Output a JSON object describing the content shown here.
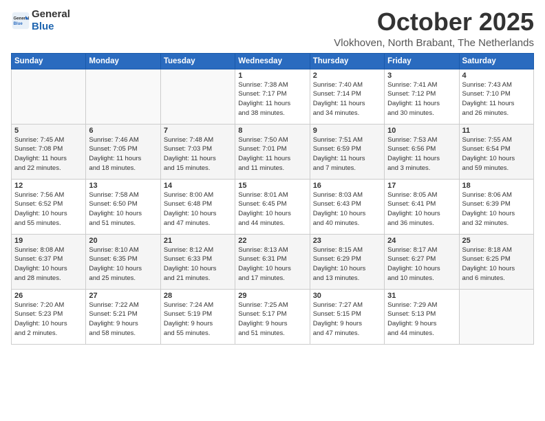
{
  "header": {
    "logo_line1": "General",
    "logo_line2": "Blue",
    "month": "October 2025",
    "location": "Vlokhoven, North Brabant, The Netherlands"
  },
  "days_of_week": [
    "Sunday",
    "Monday",
    "Tuesday",
    "Wednesday",
    "Thursday",
    "Friday",
    "Saturday"
  ],
  "weeks": [
    [
      {
        "day": "",
        "info": ""
      },
      {
        "day": "",
        "info": ""
      },
      {
        "day": "",
        "info": ""
      },
      {
        "day": "1",
        "info": "Sunrise: 7:38 AM\nSunset: 7:17 PM\nDaylight: 11 hours\nand 38 minutes."
      },
      {
        "day": "2",
        "info": "Sunrise: 7:40 AM\nSunset: 7:14 PM\nDaylight: 11 hours\nand 34 minutes."
      },
      {
        "day": "3",
        "info": "Sunrise: 7:41 AM\nSunset: 7:12 PM\nDaylight: 11 hours\nand 30 minutes."
      },
      {
        "day": "4",
        "info": "Sunrise: 7:43 AM\nSunset: 7:10 PM\nDaylight: 11 hours\nand 26 minutes."
      }
    ],
    [
      {
        "day": "5",
        "info": "Sunrise: 7:45 AM\nSunset: 7:08 PM\nDaylight: 11 hours\nand 22 minutes."
      },
      {
        "day": "6",
        "info": "Sunrise: 7:46 AM\nSunset: 7:05 PM\nDaylight: 11 hours\nand 18 minutes."
      },
      {
        "day": "7",
        "info": "Sunrise: 7:48 AM\nSunset: 7:03 PM\nDaylight: 11 hours\nand 15 minutes."
      },
      {
        "day": "8",
        "info": "Sunrise: 7:50 AM\nSunset: 7:01 PM\nDaylight: 11 hours\nand 11 minutes."
      },
      {
        "day": "9",
        "info": "Sunrise: 7:51 AM\nSunset: 6:59 PM\nDaylight: 11 hours\nand 7 minutes."
      },
      {
        "day": "10",
        "info": "Sunrise: 7:53 AM\nSunset: 6:56 PM\nDaylight: 11 hours\nand 3 minutes."
      },
      {
        "day": "11",
        "info": "Sunrise: 7:55 AM\nSunset: 6:54 PM\nDaylight: 10 hours\nand 59 minutes."
      }
    ],
    [
      {
        "day": "12",
        "info": "Sunrise: 7:56 AM\nSunset: 6:52 PM\nDaylight: 10 hours\nand 55 minutes."
      },
      {
        "day": "13",
        "info": "Sunrise: 7:58 AM\nSunset: 6:50 PM\nDaylight: 10 hours\nand 51 minutes."
      },
      {
        "day": "14",
        "info": "Sunrise: 8:00 AM\nSunset: 6:48 PM\nDaylight: 10 hours\nand 47 minutes."
      },
      {
        "day": "15",
        "info": "Sunrise: 8:01 AM\nSunset: 6:45 PM\nDaylight: 10 hours\nand 44 minutes."
      },
      {
        "day": "16",
        "info": "Sunrise: 8:03 AM\nSunset: 6:43 PM\nDaylight: 10 hours\nand 40 minutes."
      },
      {
        "day": "17",
        "info": "Sunrise: 8:05 AM\nSunset: 6:41 PM\nDaylight: 10 hours\nand 36 minutes."
      },
      {
        "day": "18",
        "info": "Sunrise: 8:06 AM\nSunset: 6:39 PM\nDaylight: 10 hours\nand 32 minutes."
      }
    ],
    [
      {
        "day": "19",
        "info": "Sunrise: 8:08 AM\nSunset: 6:37 PM\nDaylight: 10 hours\nand 28 minutes."
      },
      {
        "day": "20",
        "info": "Sunrise: 8:10 AM\nSunset: 6:35 PM\nDaylight: 10 hours\nand 25 minutes."
      },
      {
        "day": "21",
        "info": "Sunrise: 8:12 AM\nSunset: 6:33 PM\nDaylight: 10 hours\nand 21 minutes."
      },
      {
        "day": "22",
        "info": "Sunrise: 8:13 AM\nSunset: 6:31 PM\nDaylight: 10 hours\nand 17 minutes."
      },
      {
        "day": "23",
        "info": "Sunrise: 8:15 AM\nSunset: 6:29 PM\nDaylight: 10 hours\nand 13 minutes."
      },
      {
        "day": "24",
        "info": "Sunrise: 8:17 AM\nSunset: 6:27 PM\nDaylight: 10 hours\nand 10 minutes."
      },
      {
        "day": "25",
        "info": "Sunrise: 8:18 AM\nSunset: 6:25 PM\nDaylight: 10 hours\nand 6 minutes."
      }
    ],
    [
      {
        "day": "26",
        "info": "Sunrise: 7:20 AM\nSunset: 5:23 PM\nDaylight: 10 hours\nand 2 minutes."
      },
      {
        "day": "27",
        "info": "Sunrise: 7:22 AM\nSunset: 5:21 PM\nDaylight: 9 hours\nand 58 minutes."
      },
      {
        "day": "28",
        "info": "Sunrise: 7:24 AM\nSunset: 5:19 PM\nDaylight: 9 hours\nand 55 minutes."
      },
      {
        "day": "29",
        "info": "Sunrise: 7:25 AM\nSunset: 5:17 PM\nDaylight: 9 hours\nand 51 minutes."
      },
      {
        "day": "30",
        "info": "Sunrise: 7:27 AM\nSunset: 5:15 PM\nDaylight: 9 hours\nand 47 minutes."
      },
      {
        "day": "31",
        "info": "Sunrise: 7:29 AM\nSunset: 5:13 PM\nDaylight: 9 hours\nand 44 minutes."
      },
      {
        "day": "",
        "info": ""
      }
    ]
  ]
}
